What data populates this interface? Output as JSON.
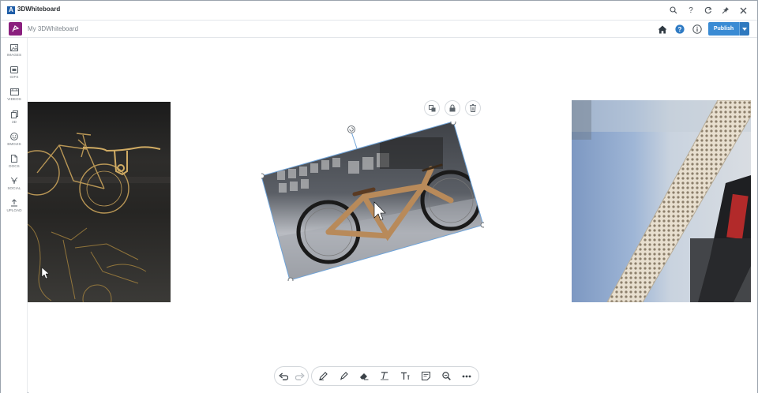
{
  "titlebar": {
    "app_title": "3DWhiteboard",
    "logo_glyph": "A",
    "controls": [
      {
        "name": "search-icon"
      },
      {
        "name": "help-icon",
        "glyph": "?"
      },
      {
        "name": "refresh-icon"
      },
      {
        "name": "pin-icon"
      },
      {
        "name": "close-icon"
      }
    ]
  },
  "header": {
    "whiteboard_name": "My 3DWhiteboard",
    "publish_label": "Publish",
    "icons": [
      "home-icon",
      "help-circle-icon",
      "info-icon"
    ],
    "accent_color": "#3a8bd4",
    "brand_color": "#8a1f7e"
  },
  "sidebar": {
    "items": [
      {
        "label": "IMAGES",
        "icon": "image-icon"
      },
      {
        "label": "GIFS",
        "icon": "gif-icon"
      },
      {
        "label": "VIDEOS",
        "icon": "video-icon"
      },
      {
        "label": "3D",
        "icon": "cube-icon"
      },
      {
        "label": "EMOJIS",
        "icon": "emoji-icon"
      },
      {
        "label": "DOCS",
        "icon": "document-icon"
      },
      {
        "label": "SOCIAL",
        "icon": "social-icon"
      },
      {
        "label": "UPLOAD",
        "icon": "upload-icon"
      }
    ]
  },
  "canvas": {
    "items": [
      {
        "name": "bike-sketch-image"
      },
      {
        "name": "wooden-bike-image",
        "selected": true
      },
      {
        "name": "bike-frame-closeup-image"
      }
    ],
    "selection_actions": [
      "duplicate-icon",
      "lock-icon",
      "trash-icon"
    ]
  },
  "toolbar": {
    "history": [
      "undo-icon",
      "redo-icon"
    ],
    "tools": [
      "pen-icon",
      "marker-icon",
      "eraser-icon",
      "text-format-icon",
      "text-icon",
      "sticky-note-icon",
      "zoom-icon",
      "more-icon"
    ]
  }
}
